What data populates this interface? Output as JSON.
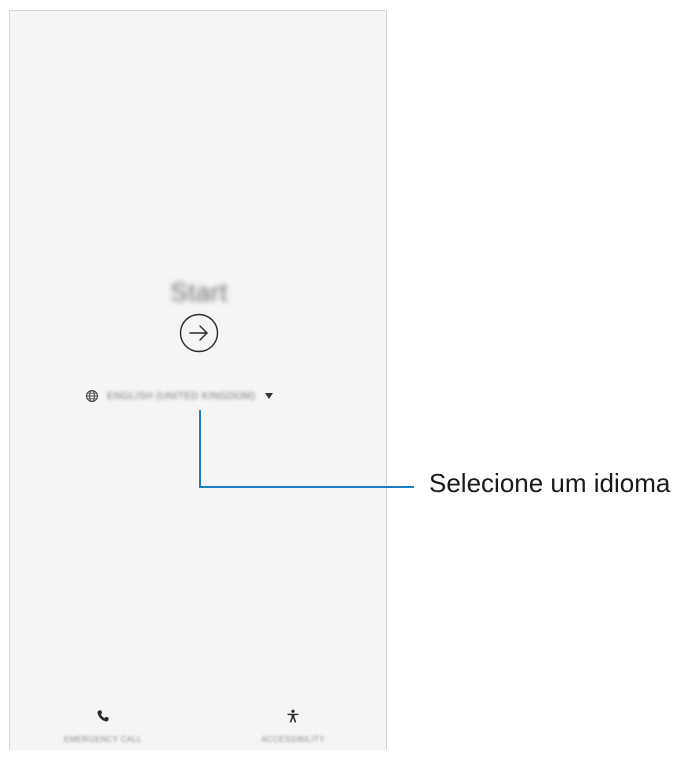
{
  "screen": {
    "title": "Start",
    "language": {
      "selected": "ENGLISH (UNITED KINGDOM)",
      "icon": "globe-icon",
      "dropdown_icon": "triangle-down-icon"
    },
    "next_icon": "arrow-right-circle-icon",
    "bottom_actions": {
      "emergency_call": {
        "label": "EMERGENCY CALL",
        "icon": "phone-icon"
      },
      "accessibility": {
        "label": "ACCESSIBILITY",
        "icon": "accessibility-icon"
      }
    }
  },
  "callout": {
    "text": "Selecione um idioma",
    "color": "#1d7fc3"
  }
}
